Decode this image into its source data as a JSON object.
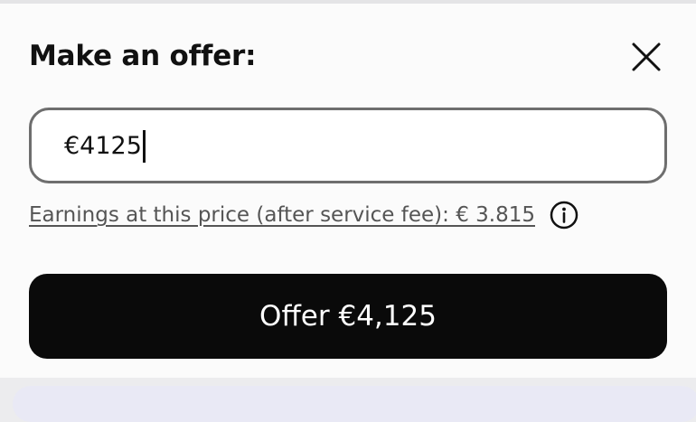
{
  "dialog": {
    "title": "Make an offer:",
    "close_icon": "close-icon"
  },
  "offer_input": {
    "value": "€4125"
  },
  "earnings": {
    "text": "Earnings at this price (after service fee): € 3.815",
    "info_icon": "info-icon"
  },
  "submit": {
    "label": "Offer €4,125"
  },
  "colors": {
    "button_background": "#0a0a0a",
    "button_text": "#ffffff",
    "input_border": "#6e6e6e",
    "link_text": "#555555",
    "sheet_background": "#fbfbfb"
  }
}
